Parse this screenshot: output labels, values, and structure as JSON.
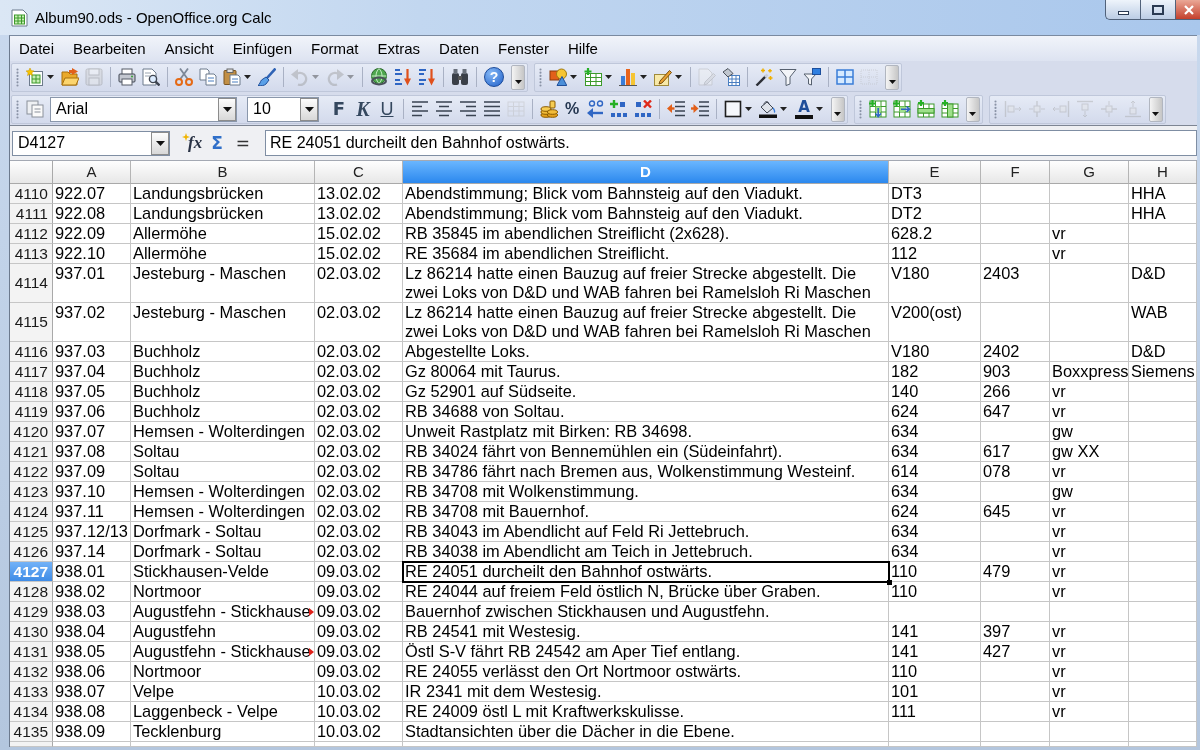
{
  "window": {
    "title": "Album90.ods - OpenOffice.org Calc"
  },
  "menu": [
    "Datei",
    "Bearbeiten",
    "Ansicht",
    "Einfügen",
    "Format",
    "Extras",
    "Daten",
    "Fenster",
    "Hilfe"
  ],
  "standard_toolbar": {
    "buttons": [
      {
        "disabled": false
      },
      {
        "disabled": false
      },
      {
        "disabled": true
      },
      {
        "disabled": false
      },
      {
        "disabled": false
      },
      {
        "disabled": false
      },
      {
        "disabled": false
      },
      {
        "disabled": false
      },
      {
        "disabled": false
      },
      {
        "disabled": true
      },
      {
        "disabled": true
      },
      {
        "disabled": false
      },
      {
        "disabled": false
      },
      {
        "disabled": false
      },
      {
        "disabled": false
      }
    ],
    "help_label": "?"
  },
  "edit_toolbar": {
    "buttons": [
      {
        "disabled": false
      },
      {
        "disabled": false
      },
      {
        "disabled": false
      },
      {
        "disabled": false
      },
      {
        "disabled": true
      },
      {
        "disabled": false
      },
      {
        "disabled": false
      },
      {
        "disabled": false
      },
      {
        "disabled": false
      },
      {
        "disabled": false
      },
      {
        "disabled": true
      }
    ]
  },
  "formatting_toolbar": {
    "font_name": "Arial",
    "font_size": "10",
    "style_buttons": [
      {
        "label": "F",
        "kind": "bold"
      },
      {
        "label": "K",
        "kind": "italic"
      },
      {
        "label": "U",
        "kind": "underline"
      }
    ],
    "percent_label": "%",
    "font_color_label": "A",
    "buttons": [
      {
        "disabled": false
      },
      {
        "disabled": false
      },
      {
        "disabled": false
      },
      {
        "disabled": false
      },
      {
        "disabled": false
      },
      {
        "disabled": true
      },
      {
        "disabled": false
      },
      {
        "disabled": false
      },
      {
        "disabled": false
      },
      {
        "disabled": false
      },
      {
        "disabled": false
      },
      {
        "disabled": false
      },
      {
        "disabled": false
      },
      {
        "disabled": false
      }
    ]
  },
  "cells_toolbar": {
    "buttons": [
      {
        "disabled": false
      },
      {
        "disabled": false
      },
      {
        "disabled": false
      },
      {
        "disabled": false
      }
    ]
  },
  "align_toolbar": {
    "buttons": [
      {
        "disabled": true
      },
      {
        "disabled": true
      },
      {
        "disabled": true
      },
      {
        "disabled": true
      },
      {
        "disabled": true
      },
      {
        "disabled": true
      }
    ]
  },
  "formula_bar": {
    "name_box": "D4127",
    "function_label": "fx",
    "sum_label": "Σ",
    "equals_label": "=",
    "content": "RE 24051 durcheilt den Bahnhof ostwärts."
  },
  "sheet": {
    "columns": [
      {
        "label": "A",
        "selected": false
      },
      {
        "label": "B",
        "selected": false
      },
      {
        "label": "C",
        "selected": false
      },
      {
        "label": "D",
        "selected": true
      },
      {
        "label": "E",
        "selected": false
      },
      {
        "label": "F",
        "selected": false
      },
      {
        "label": "G",
        "selected": false
      },
      {
        "label": "H",
        "selected": false
      }
    ],
    "rows": [
      {
        "number": "4110",
        "selected": false,
        "b_cut": false,
        "a": "922.07",
        "b": "Landungsbrücken",
        "c": "13.02.02",
        "d": "Abendstimmung; Blick vom Bahnsteig auf den Viadukt.",
        "e": "DT3",
        "h": "HHA"
      },
      {
        "number": "4111",
        "selected": false,
        "b_cut": false,
        "a": "922.08",
        "b": "Landungsbrücken",
        "c": "13.02.02",
        "d": "Abendstimmung; Blick vom Bahnsteig auf den Viadukt.",
        "e": "DT2",
        "h": "HHA"
      },
      {
        "number": "4112",
        "selected": false,
        "b_cut": false,
        "a": "922.09",
        "b": "Allermöhe",
        "c": "15.02.02",
        "d": "RB 35845 im abendlichen Streiflicht (2x628).",
        "e": "628.2",
        "g": "vr"
      },
      {
        "number": "4113",
        "selected": false,
        "b_cut": false,
        "a": "922.10",
        "b": "Allermöhe",
        "c": "15.02.02",
        "d": "RE 35684 im abendlichen Streiflicht.",
        "e": "112",
        "g": "vr"
      },
      {
        "number": "4114",
        "selected": false,
        "b_cut": false,
        "a": "937.01",
        "b": "Jesteburg - Maschen",
        "c": "02.03.02",
        "d": "Lz 86214 hatte einen Bauzug auf freier Strecke abgestellt. Die zwei Loks von D&D und WAB fahren bei Ramelsloh Ri Maschen",
        "e": "V180",
        "f": "2403",
        "h": "D&D"
      },
      {
        "number": "4115",
        "selected": false,
        "b_cut": false,
        "a": "937.02",
        "b": "Jesteburg - Maschen",
        "c": "02.03.02",
        "d": "Lz 86214 hatte einen Bauzug auf freier Strecke abgestellt. Die zwei Loks von D&D und WAB fahren bei Ramelsloh Ri Maschen",
        "e": "V200(ost)",
        "h": "WAB"
      },
      {
        "number": "4116",
        "selected": false,
        "b_cut": false,
        "a": "937.03",
        "b": "Buchholz",
        "c": "02.03.02",
        "d": "Abgestellte Loks.",
        "e": "V180",
        "f": "2402",
        "h": "D&D"
      },
      {
        "number": "4117",
        "selected": false,
        "b_cut": false,
        "a": "937.04",
        "b": "Buchholz",
        "c": "02.03.02",
        "d": "Gz 80064 mit Taurus.",
        "e": "182",
        "f": "903",
        "g": "Boxxpress",
        "h": "Siemens"
      },
      {
        "number": "4118",
        "selected": false,
        "b_cut": false,
        "a": "937.05",
        "b": "Buchholz",
        "c": "02.03.02",
        "d": "Gz 52901 auf Südseite.",
        "e": "140",
        "f": "266",
        "g": "vr"
      },
      {
        "number": "4119",
        "selected": false,
        "b_cut": false,
        "a": "937.06",
        "b": "Buchholz",
        "c": "02.03.02",
        "d": "RB 34688 von Soltau.",
        "e": "624",
        "f": "647",
        "g": "vr"
      },
      {
        "number": "4120",
        "selected": false,
        "b_cut": false,
        "a": "937.07",
        "b": "Hemsen - Wolterdingen",
        "c": "02.03.02",
        "d": "Unweit Rastplatz mit Birken: RB 34698.",
        "e": "634",
        "g": "gw"
      },
      {
        "number": "4121",
        "selected": false,
        "b_cut": false,
        "a": "937.08",
        "b": "Soltau",
        "c": "02.03.02",
        "d": "RB 34024 fährt von Bennemühlen ein (Südeinfahrt).",
        "e": "634",
        "f": "617",
        "g": "gw XX"
      },
      {
        "number": "4122",
        "selected": false,
        "b_cut": false,
        "a": "937.09",
        "b": "Soltau",
        "c": "02.03.02",
        "d": "RB 34786 fährt nach Bremen aus, Wolkenstimmung Westeinf.",
        "e": "614",
        "f": "078",
        "g": "vr"
      },
      {
        "number": "4123",
        "selected": false,
        "b_cut": false,
        "a": "937.10",
        "b": "Hemsen - Wolterdingen",
        "c": "02.03.02",
        "d": "RB 34708 mit Wolkenstimmung.",
        "e": "634",
        "g": "gw"
      },
      {
        "number": "4124",
        "selected": false,
        "b_cut": false,
        "a": "937.11",
        "b": "Hemsen - Wolterdingen",
        "c": "02.03.02",
        "d": "RB 34708 mit Bauernhof.",
        "e": "624",
        "f": "645",
        "g": "vr"
      },
      {
        "number": "4125",
        "selected": false,
        "b_cut": false,
        "a": "937.12/13",
        "b": "Dorfmark - Soltau",
        "c": "02.03.02",
        "d": "RB 34043 im Abendlicht auf Feld Ri Jettebruch.",
        "e": "634",
        "g": "vr"
      },
      {
        "number": "4126",
        "selected": false,
        "b_cut": false,
        "a": "937.14",
        "b": "Dorfmark - Soltau",
        "c": "02.03.02",
        "d": "RB 34038 im Abendlicht am Teich in Jettebruch.",
        "e": "634",
        "g": "vr"
      },
      {
        "number": "4127",
        "selected": true,
        "b_cut": false,
        "a": "938.01",
        "b": "Stickhausen-Velde",
        "c": "09.03.02",
        "d": "RE 24051 durcheilt den Bahnhof ostwärts.",
        "e": "110",
        "f": "479",
        "g": "vr"
      },
      {
        "number": "4128",
        "selected": false,
        "b_cut": false,
        "a": "938.02",
        "b": "Nortmoor",
        "c": "09.03.02",
        "d": "RE 24044 auf freiem Feld östlich N, Brücke über Graben.",
        "e": "110",
        "g": "vr"
      },
      {
        "number": "4129",
        "selected": false,
        "b_cut": true,
        "a": "938.03",
        "b": "Augustfehn - Stickhause",
        "c": "09.03.02",
        "d": "Bauernhof zwischen Stickhausen und Augustfehn."
      },
      {
        "number": "4130",
        "selected": false,
        "b_cut": false,
        "a": "938.04",
        "b": "Augustfehn",
        "c": "09.03.02",
        "d": "RB 24541 mit Westesig.",
        "e": "141",
        "f": "397",
        "g": "vr"
      },
      {
        "number": "4131",
        "selected": false,
        "b_cut": true,
        "a": "938.05",
        "b": "Augustfehn - Stickhause",
        "c": "09.03.02",
        "d": "Östl S-V fährt RB 24542 am Aper Tief entlang.",
        "e": "141",
        "f": "427",
        "g": "vr"
      },
      {
        "number": "4132",
        "selected": false,
        "b_cut": false,
        "a": "938.06",
        "b": "Nortmoor",
        "c": "09.03.02",
        "d": "RE 24055 verlässt den Ort Nortmoor ostwärts.",
        "e": "110",
        "g": "vr"
      },
      {
        "number": "4133",
        "selected": false,
        "b_cut": false,
        "a": "938.07",
        "b": "Velpe",
        "c": "10.03.02",
        "d": "IR 2341 mit dem Westesig.",
        "e": "101",
        "g": "vr"
      },
      {
        "number": "4134",
        "selected": false,
        "b_cut": false,
        "a": "938.08",
        "b": "Laggenbeck - Velpe",
        "c": "10.03.02",
        "d": "RE 24009 östl L mit Kraftwerkskulisse.",
        "e": "111",
        "g": "vr"
      },
      {
        "number": "4135",
        "selected": false,
        "b_cut": false,
        "a": "938.09",
        "b": "Tecklenburg",
        "c": "10.03.02",
        "d": "Stadtansichten über die Dächer in die Ebene."
      }
    ]
  }
}
